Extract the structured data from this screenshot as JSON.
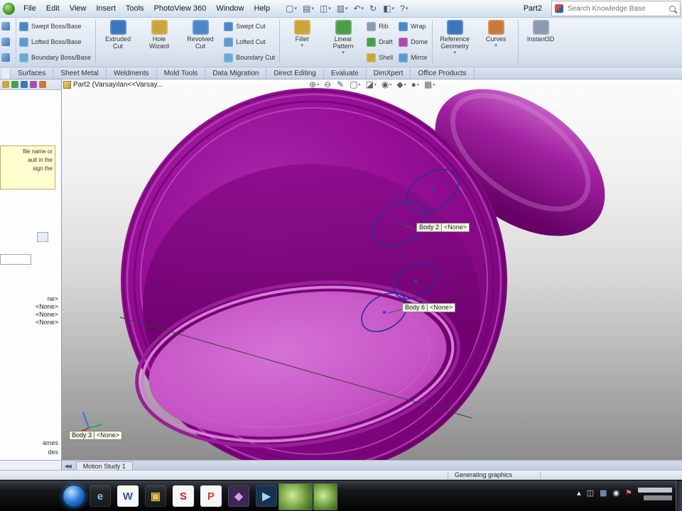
{
  "colors": {
    "model_outer": "#8a0a8a",
    "model_floor": "#c653c6",
    "selection_accent": "#2b7cd8",
    "note_background": "#ffffcf"
  },
  "menu_bar": {
    "menus": [
      "File",
      "Edit",
      "View",
      "Insert",
      "Tools",
      "PhotoView 360",
      "Window",
      "Help"
    ],
    "title": "Part2",
    "search_placeholder": "Search Knowledge Base",
    "quick_icons": [
      {
        "name": "new-document-icon",
        "glyph": "▢",
        "caret": "▾"
      },
      {
        "name": "open-icon",
        "glyph": "▤",
        "caret": "▾"
      },
      {
        "name": "save-icon",
        "glyph": "◫",
        "caret": "▾"
      },
      {
        "name": "print-icon",
        "glyph": "▥",
        "caret": "▾"
      },
      {
        "name": "undo-icon",
        "glyph": "↶",
        "caret": "▾"
      },
      {
        "name": "rebuild-icon",
        "glyph": "↻",
        "caret": ""
      },
      {
        "name": "options-icon",
        "glyph": "◧",
        "caret": "▾"
      },
      {
        "name": "help-icon",
        "glyph": "?",
        "caret": "▾"
      }
    ]
  },
  "ribbon": {
    "boss_group": [
      {
        "name": "swept-boss-base-button",
        "label": "Swept Boss/Base",
        "c": "#4a86c8"
      },
      {
        "name": "lofted-boss-base-button",
        "label": "Lofted Boss/Base",
        "c": "#5a9ad0"
      },
      {
        "name": "boundary-boss-base-button",
        "label": "Boundary Boss/Base",
        "c": "#6aa8d8"
      }
    ],
    "cut_big_group": [
      {
        "name": "extruded-cut-button",
        "label": "Extruded Cut",
        "c": "#3a76bb",
        "caret": ""
      },
      {
        "name": "hole-wizard-button",
        "label": "Hole Wizard",
        "c": "#caa53a",
        "caret": ""
      },
      {
        "name": "revolved-cut-button",
        "label": "Revolved Cut",
        "c": "#4a86c8",
        "caret": ""
      }
    ],
    "cut_stack_group": [
      {
        "name": "swept-cut-button",
        "label": "Swept Cut",
        "c": "#4a86c8"
      },
      {
        "name": "lofted-cut-button",
        "label": "Lofted Cut",
        "c": "#5a9ad0"
      },
      {
        "name": "boundary-cut-button",
        "label": "Boundary Cut",
        "c": "#6aa8d8"
      }
    ],
    "feature_big_group": [
      {
        "name": "fillet-button",
        "label": "Fillet",
        "c": "#caa53a",
        "caret": "▾"
      },
      {
        "name": "linear-pattern-button",
        "label": "Linear Pattern",
        "c": "#4a9e4a",
        "caret": "▾"
      }
    ],
    "rib_stack_group": [
      {
        "name": "rib-button",
        "label": "Rib",
        "c": "#8a9ab0"
      },
      {
        "name": "draft-button",
        "label": "Draft",
        "c": "#4a9e4a"
      },
      {
        "name": "shell-button",
        "label": "Shell",
        "c": "#caa53a"
      }
    ],
    "wrap_stack_group": [
      {
        "name": "wrap-button",
        "label": "Wrap",
        "c": "#4a86c8"
      },
      {
        "name": "dome-button",
        "label": "Dome",
        "c": "#b04ab0"
      },
      {
        "name": "mirror-button",
        "label": "Mirror",
        "c": "#5a9ad0"
      }
    ],
    "reference_big_group": [
      {
        "name": "reference-geometry-button",
        "label": "Reference Geometry",
        "c": "#3a76bb",
        "caret": "▾"
      },
      {
        "name": "curves-button",
        "label": "Curves",
        "c": "#c87a3a",
        "caret": "▾"
      }
    ],
    "instant_big_group": [
      {
        "name": "instant3d-button",
        "label": "Instant3D",
        "c": "#8a9ab0",
        "caret": ""
      }
    ]
  },
  "tabs": [
    {
      "label": "Surfaces"
    },
    {
      "label": "Sheet Metal"
    },
    {
      "label": "Weldments"
    },
    {
      "label": "Mold Tools"
    },
    {
      "label": "Data Migration"
    },
    {
      "label": "Direct Editing"
    },
    {
      "label": "Evaluate"
    },
    {
      "label": "DimXpert"
    },
    {
      "label": "Office Products"
    }
  ],
  "feature_panel": {
    "toolbar_icons": [
      {
        "name": "featuremanager-tree-tab-icon",
        "c": "#caa53a"
      },
      {
        "name": "propertymanager-tab-icon",
        "c": "#4a9e4a"
      },
      {
        "name": "configurationmanager-tab-icon",
        "c": "#3a76bb"
      },
      {
        "name": "dimxpertmanager-tab-icon",
        "c": "#b04ab0"
      },
      {
        "name": "displaymanager-tab-icon",
        "c": "#c87a3a"
      }
    ],
    "note_lines": [
      "file name or",
      "ault in the",
      "sign the"
    ],
    "rows": [
      "ne>",
      "<None>",
      "<None>",
      "<None>"
    ],
    "bottom_labels": [
      "ames",
      "des"
    ]
  },
  "viewport": {
    "doc_label": "Part2 (Varsayılan<<Varsay...",
    "callouts": [
      {
        "label": "Body 2",
        "value": "<None>"
      },
      {
        "label": "Body 6",
        "value": "<None>"
      },
      {
        "label": "Body 3",
        "value": "<None>"
      }
    ],
    "hud_icons": [
      {
        "name": "zoom-to-fit-icon",
        "glyph": "⊕",
        "caret": "▾"
      },
      {
        "name": "zoom-to-area-icon",
        "glyph": "⊖",
        "caret": ""
      },
      {
        "name": "sketch-pencil-icon",
        "glyph": "✎",
        "caret": "",
        "color": "#2b56c4"
      },
      {
        "name": "view-orientation-icon",
        "glyph": "▢",
        "caret": "▾"
      },
      {
        "name": "display-style-icon",
        "glyph": "◪",
        "caret": "▾"
      },
      {
        "name": "hide-show-items-icon",
        "glyph": "◉",
        "caret": "▾"
      },
      {
        "name": "edit-appearance-icon",
        "glyph": "◆",
        "caret": "▾"
      },
      {
        "name": "apply-scene-icon",
        "glyph": "●",
        "caret": "▾"
      },
      {
        "name": "view-settings-icon",
        "glyph": "▦",
        "caret": "▾"
      }
    ]
  },
  "motion_bar": {
    "nav": "◀◀",
    "tabs": [
      {
        "label": "Motion Study 1"
      }
    ]
  },
  "status_bar": {
    "message": "Generating graphics"
  },
  "taskbar": {
    "icons": [
      {
        "name": "internet-explorer-icon",
        "glyph": "e",
        "fg": "#7cc0f5",
        "bg": ""
      },
      {
        "name": "word-icon",
        "glyph": "W",
        "fg": "#2b579a",
        "bg": "#f5f6f8"
      },
      {
        "name": "folder-icon",
        "glyph": "▣",
        "fg": "#e8c24a",
        "bg": ""
      },
      {
        "name": "solidworks-icon",
        "glyph": "S",
        "fg": "#cf1f1f",
        "bg": "#f5f6f8"
      },
      {
        "name": "powerpoint-icon",
        "glyph": "P",
        "fg": "#d04423",
        "bg": "#f5f6f8"
      },
      {
        "name": "app-purple-icon",
        "glyph": "◆",
        "fg": "#cfa0e8",
        "bg": "#3d2752"
      },
      {
        "name": "media-player-icon",
        "glyph": "▶",
        "fg": "#9fd4ff",
        "bg": "#16324f"
      }
    ],
    "tray_icons": [
      {
        "name": "tray-expand-icon",
        "glyph": "▴",
        "fg": "#e8edf3"
      },
      {
        "name": "tray-app-icon",
        "glyph": "◫",
        "fg": "#cfd8e2"
      },
      {
        "name": "tray-network-icon",
        "glyph": "▦",
        "fg": "#9fc4e8"
      },
      {
        "name": "tray-volume-icon",
        "glyph": "◉",
        "fg": "#e8edf3"
      },
      {
        "name": "tray-flag-icon",
        "glyph": "⚑",
        "fg": "#e86a6a"
      }
    ]
  }
}
